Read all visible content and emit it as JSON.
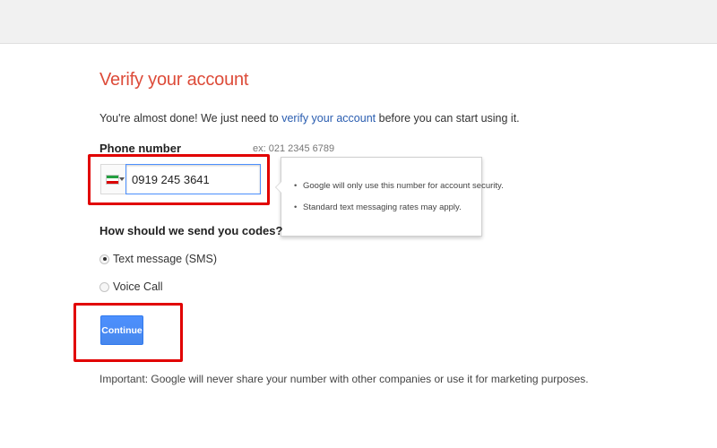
{
  "page": {
    "title": "Verify your account",
    "intro_before": "You're almost done! We just need to ",
    "intro_link": "verify your account",
    "intro_after": " before you can start using it."
  },
  "phone": {
    "label": "Phone number",
    "example": "ex: 021 2345 6789",
    "country_flag": "iran-flag-icon",
    "value": "0919 245 3641"
  },
  "tooltip": {
    "items": [
      "Google will only use this number for account security.",
      "Standard text messaging rates may apply."
    ]
  },
  "delivery": {
    "label": "How should we send you codes?",
    "options": [
      {
        "label": "Text message (SMS)",
        "selected": true
      },
      {
        "label": "Voice Call",
        "selected": false
      }
    ]
  },
  "actions": {
    "continue_label": "Continue"
  },
  "footer": {
    "important": "Important: Google will never share your number with other companies or use it for marketing purposes."
  },
  "colors": {
    "title": "#dd4b39",
    "link": "#2a5db0",
    "button": "#4d90fe",
    "highlight": "#e10000"
  }
}
